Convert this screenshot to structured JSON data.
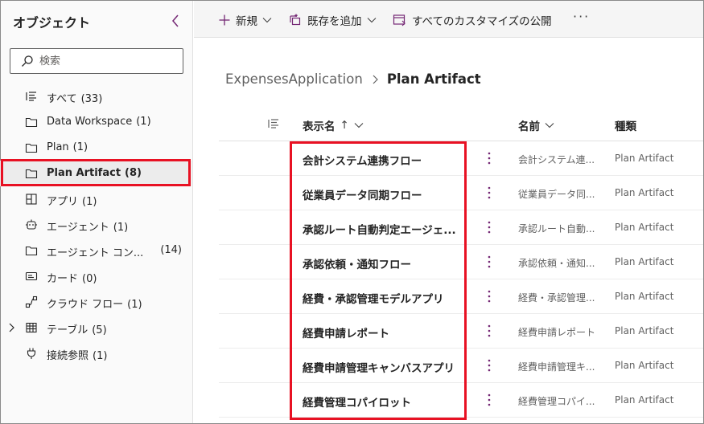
{
  "sidebar": {
    "title": "オブジェクト",
    "search_placeholder": "検索",
    "items": [
      {
        "label": "すべて",
        "count": "(33)",
        "icon": "list-icon"
      },
      {
        "label": "Data Workspace",
        "count": "(1)",
        "icon": "folder-icon"
      },
      {
        "label": "Plan",
        "count": "(1)",
        "icon": "folder-icon"
      },
      {
        "label": "Plan Artifact",
        "count": "(8)",
        "icon": "folder-icon",
        "selected": true
      },
      {
        "label": "アプリ",
        "count": "(1)",
        "icon": "app-icon"
      },
      {
        "label": "エージェント",
        "count": "(1)",
        "icon": "agent-icon"
      },
      {
        "label": "エージェント コン...",
        "count": "(14)",
        "icon": "folder-icon"
      },
      {
        "label": "カード",
        "count": "(0)",
        "icon": "card-icon"
      },
      {
        "label": "クラウド フロー",
        "count": "(1)",
        "icon": "flow-icon"
      },
      {
        "label": "テーブル",
        "count": "(5)",
        "icon": "table-icon"
      },
      {
        "label": "接続参照",
        "count": "(1)",
        "icon": "plug-icon"
      }
    ]
  },
  "toolbar": {
    "new_label": "新規",
    "add_existing_label": "既存を追加",
    "publish_label": "すべてのカスタマイズの公開",
    "more_label": "···"
  },
  "breadcrumb": {
    "parent": "ExpensesApplication",
    "current": "Plan Artifact"
  },
  "table": {
    "headers": {
      "display_name": "表示名",
      "sort_arrow": "↑",
      "name": "名前",
      "type": "種類"
    },
    "rows": [
      {
        "display": "会計システム連携フロー",
        "name": "会計システム連...",
        "type": "Plan Artifact"
      },
      {
        "display": "従業員データ同期フロー",
        "name": "従業員データ同...",
        "type": "Plan Artifact"
      },
      {
        "display": "承認ルート自動判定エージェ...",
        "name": "承認ルート自動...",
        "type": "Plan Artifact"
      },
      {
        "display": "承認依頼・通知フロー",
        "name": "承認依頼・通知...",
        "type": "Plan Artifact"
      },
      {
        "display": "経費・承認管理モデルアプリ",
        "name": "経費・承認管理...",
        "type": "Plan Artifact"
      },
      {
        "display": "経費申請レポート",
        "name": "経費申請レポート",
        "type": "Plan Artifact"
      },
      {
        "display": "経費申請管理キャンバスアプリ",
        "name": "経費申請管理キ...",
        "type": "Plan Artifact"
      },
      {
        "display": "経費管理コパイロット",
        "name": "経費管理コパイ...",
        "type": "Plan Artifact"
      }
    ]
  },
  "colors": {
    "highlight": "#e81123",
    "accent": "#742774"
  }
}
